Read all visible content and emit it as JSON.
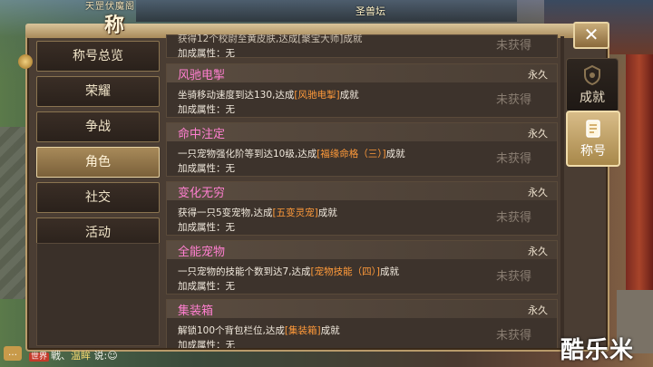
{
  "header": {
    "subtitle": "天罡伏魔阁",
    "title": "称号",
    "map_name": "圣兽坛"
  },
  "menu": [
    {
      "label": "称号总览",
      "active": false
    },
    {
      "label": "荣耀",
      "active": false
    },
    {
      "label": "争战",
      "active": false
    },
    {
      "label": "角色",
      "active": true
    },
    {
      "label": "社交",
      "active": false
    },
    {
      "label": "活动",
      "active": false
    }
  ],
  "partial_card": {
    "desc": "获得12个校尉至黄皮肤,达成[聚宝大师]成就",
    "attr": "加成属性：无",
    "status": "未获得"
  },
  "cards": [
    {
      "name": "风驰电掣",
      "duration": "永久",
      "desc_pre": "坐骑移动速度到达130,达成",
      "desc_hl": "[风驰电掣]",
      "desc_post": "成就",
      "attr": "加成属性：无",
      "status": "未获得"
    },
    {
      "name": "命中注定",
      "duration": "永久",
      "desc_pre": "一只宠物强化阶等到达10级,达成",
      "desc_hl": "[福缘命格（三）]",
      "desc_post": "成就",
      "attr": "加成属性：无",
      "status": "未获得"
    },
    {
      "name": "变化无穷",
      "duration": "永久",
      "desc_pre": "获得一只5变宠物,达成",
      "desc_hl": "[五变灵宠]",
      "desc_post": "成就",
      "attr": "加成属性：无",
      "status": "未获得"
    },
    {
      "name": "全能宠物",
      "duration": "永久",
      "desc_pre": "一只宠物的技能个数到达7,达成",
      "desc_hl": "[宠物技能（四）]",
      "desc_post": "成就",
      "attr": "加成属性：无",
      "status": "未获得"
    },
    {
      "name": "集装箱",
      "duration": "永久",
      "desc_pre": "解锁100个背包栏位,达成",
      "desc_hl": "[集装箱]",
      "desc_post": "成就",
      "attr": "加成属性：无",
      "status": "未获得"
    }
  ],
  "right_tabs": [
    {
      "label": "成就",
      "icon": "shield-emblem-icon"
    },
    {
      "label": "称号",
      "icon": "scroll-badge-icon"
    }
  ],
  "close_icon": "close-icon",
  "chat": {
    "tag": "世界",
    "text_a": "戦、",
    "name": "温眸",
    "text_b": " 说:",
    "emoji": "smiley-emoji-icon"
  },
  "watermark": "酷乐米",
  "colors": {
    "title_pink": "#ff7fd0",
    "highlight_orange": "#ff9a3a",
    "unearned_gray": "#8a7e72"
  }
}
